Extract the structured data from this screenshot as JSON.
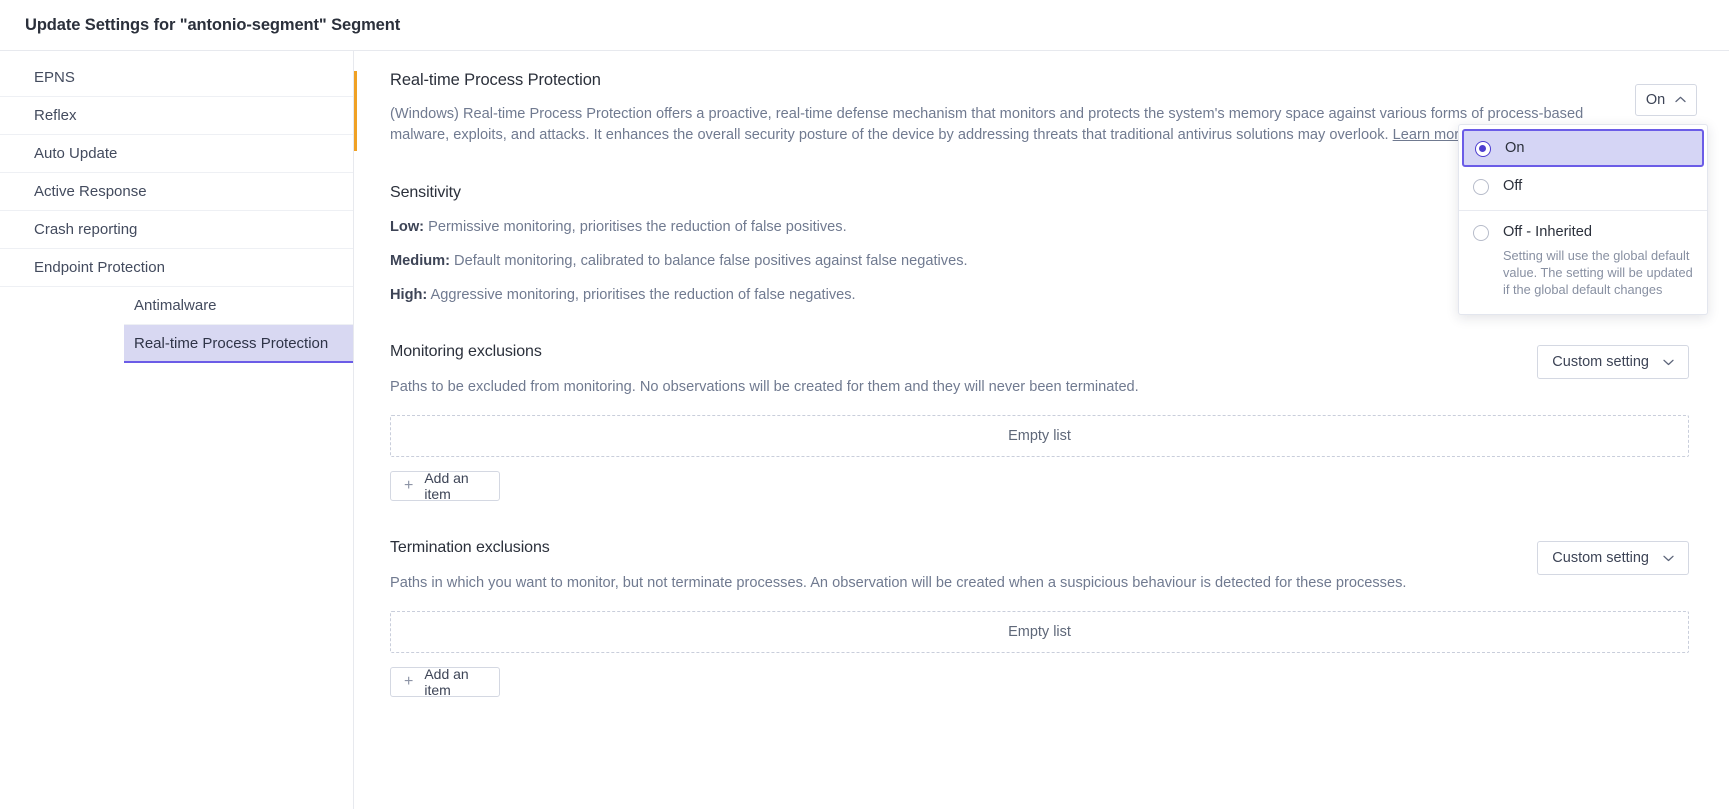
{
  "window": {
    "title": "Update Settings for \"antonio-segment\" Segment"
  },
  "sidebar": {
    "items": [
      {
        "label": "EPNS",
        "level": 1,
        "selected": false
      },
      {
        "label": "Reflex",
        "level": 1,
        "selected": false
      },
      {
        "label": "Auto Update",
        "level": 1,
        "selected": false
      },
      {
        "label": "Active Response",
        "level": 1,
        "selected": false
      },
      {
        "label": "Crash reporting",
        "level": 1,
        "selected": false
      },
      {
        "label": "Endpoint Protection",
        "level": 1,
        "selected": false
      },
      {
        "label": "Antimalware",
        "level": 2,
        "selected": false
      },
      {
        "label": "Real-time Process Protection",
        "level": 2,
        "selected": true
      }
    ]
  },
  "main": {
    "header": {
      "title": "Real-time Process Protection",
      "description_part1": "(Windows) Real-time Process Protection offers a proactive, real-time defense mechanism that monitors and protects the system's memory space against various forms of process-based malware, exploits, and attacks. It enhances the overall security posture of the device by addressing threats that traditional antivirus solutions may overlook. ",
      "learn_more_label": "Learn more ↗",
      "accent_color": "#f0a124"
    },
    "state_toggle": {
      "value": "On",
      "chevron": "⌃"
    },
    "dropdown": {
      "open": true,
      "options": [
        {
          "label": "On",
          "selected": true,
          "sub": ""
        },
        {
          "label": "Off",
          "selected": false,
          "sub": ""
        },
        {
          "label": "Off - Inherited",
          "selected": false,
          "sub": "Setting will use the global default value. The setting will be updated if the global default changes"
        }
      ],
      "selected_color": "#4e3fd0",
      "selected_bg": "#d5d5f5"
    },
    "sensitivity": {
      "title": "Sensitivity",
      "levels": [
        {
          "name": "Low:",
          "text": " Permissive monitoring, prioritises the reduction of false positives."
        },
        {
          "name": "Medium:",
          "text": " Default monitoring, calibrated to balance false positives against false negatives."
        },
        {
          "name": "High:",
          "text": " Aggressive monitoring, prioritises the reduction of false negatives."
        }
      ]
    },
    "monitoring_exclusions": {
      "title": "Monitoring exclusions",
      "description": "Paths to be excluded from monitoring. No observations will be created for them and they will never been terminated.",
      "setting_label": "Custom setting",
      "setting_chevron": "⌄",
      "empty_label": "Empty list",
      "add_label": "Add an item",
      "add_icon": "+"
    },
    "termination_exclusions": {
      "title": "Termination exclusions",
      "description": "Paths in which you want to monitor, but not terminate processes. An observation will be created when a suspicious behaviour is detected for these processes.",
      "setting_label": "Custom setting",
      "setting_chevron": "⌄",
      "empty_label": "Empty list",
      "add_label": "Add an item",
      "add_icon": "+"
    }
  }
}
